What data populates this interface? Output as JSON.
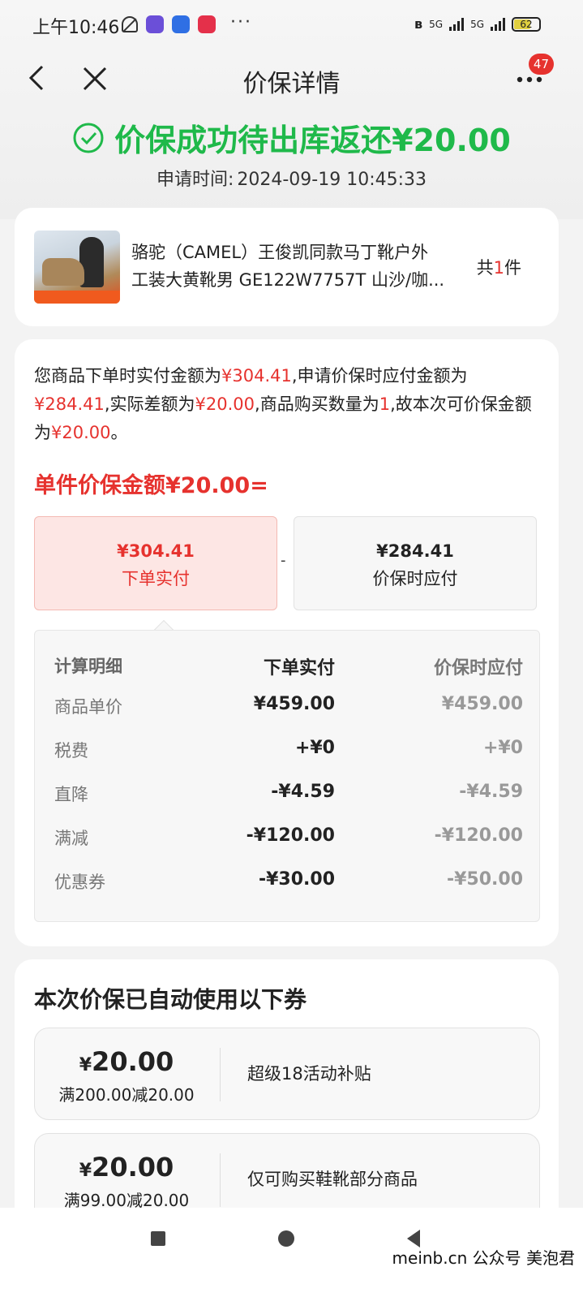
{
  "status_bar": {
    "time": "上午10:46",
    "network_1": "5G",
    "network_2": "5G",
    "battery": "62"
  },
  "nav": {
    "title": "价保详情",
    "badge_count": "47"
  },
  "result": {
    "status_text": "价保成功待出库返还¥20.00",
    "apply_time_label": "申请时间:",
    "apply_time_value": "2024-09-19 10:45:33"
  },
  "product": {
    "name_line1": "骆驼（CAMEL）王俊凯同款马丁靴户外",
    "name_line2": "工装大黄靴男 GE122W7757T 山沙/咖...",
    "qty_prefix": "共",
    "qty_value": "1",
    "qty_suffix": "件"
  },
  "explanation": {
    "t1": "您商品下单时实付金额为",
    "paid": "¥304.41",
    "t2": ",申请价保时应付金额为",
    "due": "¥284.41",
    "t3": ",实际差额为",
    "diff": "¥20.00",
    "t4": ",商品购买数量为",
    "qty": "1",
    "t5": ",故本次可价保金额为",
    "refund": "¥20.00",
    "t6": "。"
  },
  "unit_refund_title": "单件价保金额¥20.00=",
  "compare": {
    "left_amount": "¥304.41",
    "left_label": "下单实付",
    "minus": "-",
    "right_amount": "¥284.41",
    "right_label": "价保时应付"
  },
  "calc": {
    "headers": [
      "计算明细",
      "下单实付",
      "价保时应付"
    ],
    "rows": [
      [
        "商品单价",
        "¥459.00",
        "¥459.00"
      ],
      [
        "税费",
        "+¥0",
        "+¥0"
      ],
      [
        "直降",
        "-¥4.59",
        "-¥4.59"
      ],
      [
        "满减",
        "-¥120.00",
        "-¥120.00"
      ],
      [
        "优惠券",
        "-¥30.00",
        "-¥50.00"
      ]
    ]
  },
  "coupons": {
    "title": "本次价保已自动使用以下券",
    "items": [
      {
        "yen": "¥",
        "amount": "20.00",
        "condition": "满200.00减20.00",
        "desc": "超级18活动补贴"
      },
      {
        "yen": "¥",
        "amount": "20.00",
        "condition": "满99.00减20.00",
        "desc": "仅可购买鞋靴部分商品"
      }
    ]
  },
  "watermark": "meinb.cn  公众号 美泡君",
  "colors": {
    "success_green": "#1fb94a",
    "price_red": "#e6322e",
    "page_bg": "#f3f3f3"
  }
}
